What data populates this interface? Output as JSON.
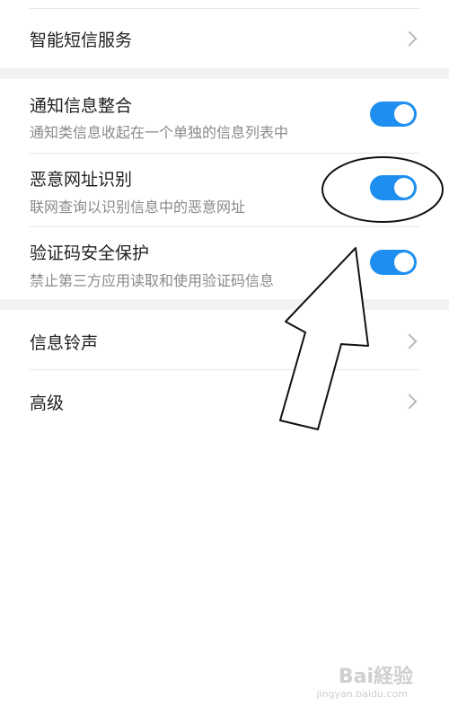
{
  "settings": {
    "smart_sms": {
      "title": "智能短信服务"
    },
    "notification_merge": {
      "title": "通知信息整合",
      "subtitle": "通知类信息收起在一个单独的信息列表中",
      "enabled": true
    },
    "malicious_url": {
      "title": "恶意网址识别",
      "subtitle": "联网查询以识别信息中的恶意网址",
      "enabled": true
    },
    "verification_code": {
      "title": "验证码安全保护",
      "subtitle": "禁止第三方应用读取和使用验证码信息",
      "enabled": true
    },
    "ringtone": {
      "title": "信息铃声"
    },
    "advanced": {
      "title": "高级"
    }
  },
  "icons": {
    "chevron": "chevron-right-icon"
  },
  "colors": {
    "toggle_on": "#1e8ff0",
    "section_gap": "#f2f2f2",
    "subtitle": "#8a8a8a"
  },
  "watermark": {
    "text": "Bai経验",
    "url": "jingyan.baidu.com"
  }
}
